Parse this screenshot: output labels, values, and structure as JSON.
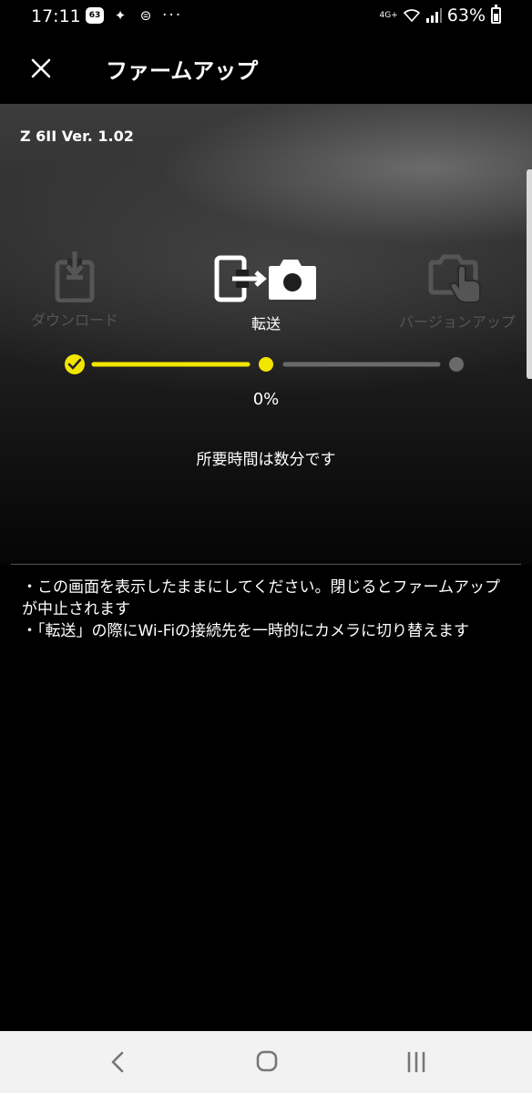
{
  "status_bar": {
    "time": "17:11",
    "notification_badge": "63",
    "overflow_dots": "···",
    "network_type": "4G+",
    "battery_percent": "63%",
    "battery_level": 0.63
  },
  "app_bar": {
    "title": "ファームアップ"
  },
  "hero": {
    "device_version": "Z 6II Ver. 1.02",
    "steps": [
      {
        "label": "ダウンロード",
        "state": "done"
      },
      {
        "label": "転送",
        "state": "active"
      },
      {
        "label": "バージョンアップ",
        "state": "pending"
      }
    ],
    "progress_percent": "0%",
    "time_note": "所要時間は数分です"
  },
  "notes": [
    "・この画面を表示したままにしてください。閉じるとファームアップが中止されます",
    "・「転送」の際にWi-Fiの接続先を一時的にカメラに切り替えます"
  ],
  "colors": {
    "accent": "#f2e600",
    "inactive": "#555555",
    "track_gray": "#6a6a6a"
  }
}
